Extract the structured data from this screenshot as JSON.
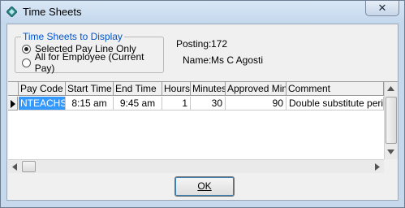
{
  "window": {
    "title": "Time Sheets",
    "close_glyph": "✕"
  },
  "display_group": {
    "legend": "Time Sheets to Display",
    "options": [
      "Selected Pay Line Only",
      "All for Employee (Current Pay)"
    ],
    "selected_index": 0
  },
  "info": {
    "posting_label": "Posting:",
    "posting_value": "172",
    "name_label": "Name:",
    "name_value": "Ms C Agosti"
  },
  "grid": {
    "columns": [
      "Pay Code",
      "Start Time",
      "End Time",
      "Hours",
      "Minutes",
      "Approved Mins",
      "Comment"
    ],
    "rows": [
      {
        "pay_code": "NTEACHS",
        "start_time": "8:15 am",
        "end_time": "9:45 am",
        "hours": "1",
        "minutes": "30",
        "approved_mins": "90",
        "comment": "Double substitute period"
      }
    ]
  },
  "buttons": {
    "ok": "OK"
  }
}
